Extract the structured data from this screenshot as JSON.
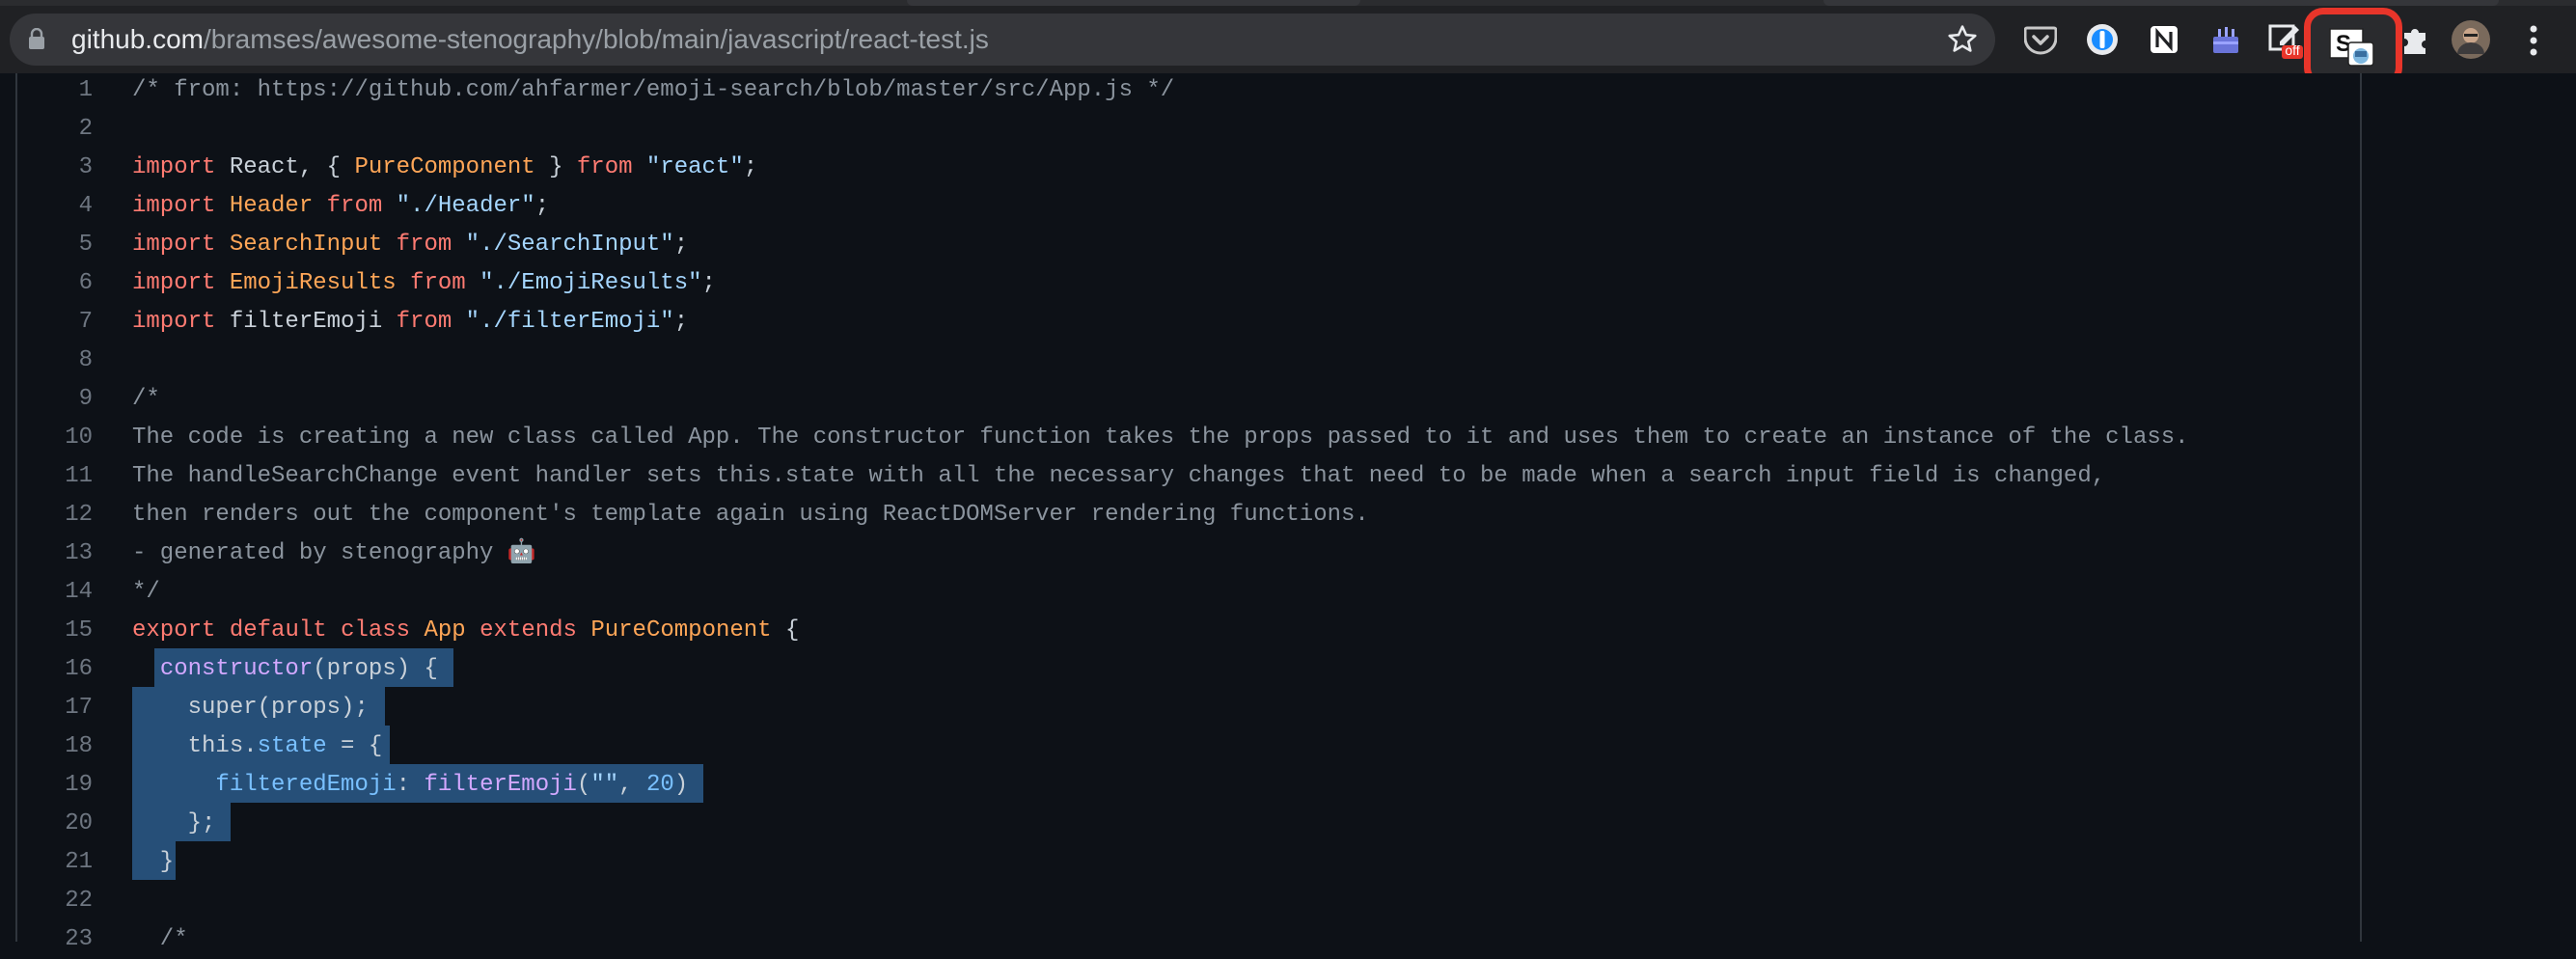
{
  "browser": {
    "url_host": "github.com",
    "url_path": "/bramses/awesome-stenography/blob/main/javascript/react-test.js",
    "extensions": [
      "pocket-icon",
      "one-password-icon",
      "notion-icon",
      "cake-icon",
      "edit-extension-icon",
      "stenography-extension-icon",
      "puzzle-icon",
      "avatar"
    ],
    "badge_text": "off",
    "highlight_color": "#e8352a"
  },
  "code": {
    "line_numbers": [
      "1",
      "2",
      "3",
      "4",
      "5",
      "6",
      "7",
      "8",
      "9",
      "10",
      "11",
      "12",
      "13",
      "14",
      "15",
      "16",
      "17",
      "18",
      "19",
      "20",
      "21",
      "22",
      "23"
    ],
    "lines": {
      "l1": "/* from: https://github.com/ahfarmer/emoji-search/blob/master/src/App.js */",
      "l3": [
        "import",
        " React",
        ", { ",
        "PureComponent",
        " } ",
        "from",
        " ",
        "\"react\"",
        ";"
      ],
      "l4": [
        "import",
        " Header ",
        "from",
        " ",
        "\"./Header\"",
        ";"
      ],
      "l5": [
        "import",
        " SearchInput ",
        "from",
        " ",
        "\"./SearchInput\"",
        ";"
      ],
      "l6": [
        "import",
        " EmojiResults ",
        "from",
        " ",
        "\"./EmojiResults\"",
        ";"
      ],
      "l7": [
        "import",
        " filterEmoji ",
        "from",
        " ",
        "\"./filterEmoji\"",
        ";"
      ],
      "l9": "/*",
      "l10": "The code is creating a new class called App. The constructor function takes the props passed to it and uses them to create an instance of the class.",
      "l11": "The handleSearchChange event handler sets this.state with all the necessary changes that need to be made when a search input field is changed,",
      "l12": "then renders out the component's template again using ReactDOMServer rendering functions.",
      "l13": "- generated by stenography 🤖",
      "l14": "*/",
      "l15": [
        "export",
        " ",
        "default",
        " ",
        "class",
        " ",
        "App",
        " ",
        "extends",
        " ",
        "PureComponent",
        " {"
      ],
      "l16": [
        "  ",
        "constructor",
        "(props) {"
      ],
      "l17": "    super(props);",
      "l18": [
        "    this.",
        "state",
        " = {"
      ],
      "l19": [
        "      ",
        "filteredEmoji",
        ": ",
        "filterEmoji",
        "(",
        "\"\"",
        ", ",
        "20",
        ")"
      ],
      "l20": "    };",
      "l21": "  }",
      "l23": "  /*"
    }
  },
  "colors": {
    "background": "#0d1117",
    "selection": "#264f78",
    "keyword": "#ff7b72",
    "class_name": "#ffa657",
    "string": "#a5d6ff",
    "comment": "#8b949e",
    "function": "#d2a8ff",
    "property": "#79c0ff"
  }
}
